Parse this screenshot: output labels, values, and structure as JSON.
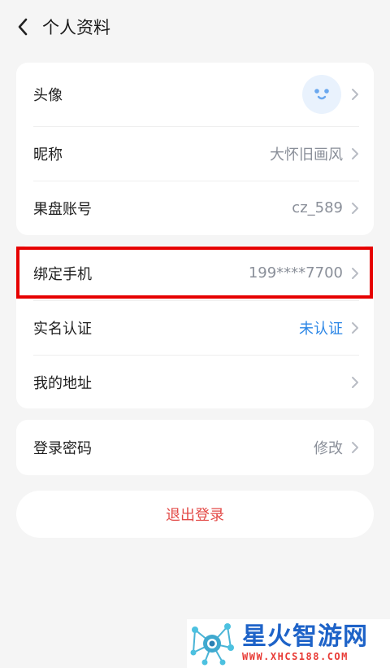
{
  "header": {
    "title": "个人资料"
  },
  "profile": [
    {
      "label": "头像",
      "value": ""
    },
    {
      "label": "昵称",
      "value": "大怀旧画风"
    },
    {
      "label": "果盘账号",
      "value": "cz_589"
    }
  ],
  "account": [
    {
      "label": "绑定手机",
      "value": "199****7700"
    },
    {
      "label": "实名认证",
      "value": "未认证"
    },
    {
      "label": "我的地址",
      "value": ""
    }
  ],
  "security": [
    {
      "label": "登录密码",
      "value": "修改"
    }
  ],
  "logout_label": "退出登录",
  "watermark": {
    "brand": "星火智游网",
    "url": "WWW.XHCS188.COM"
  },
  "colors": {
    "accent_blue": "#2b86e6",
    "logout_red": "#e34a47",
    "highlight_red": "#e60000",
    "value_gray": "#8a8f99"
  },
  "icons": [
    "back-arrow-icon",
    "chevron-right-icon",
    "avatar-smiley-icon",
    "network-logo-icon"
  ]
}
